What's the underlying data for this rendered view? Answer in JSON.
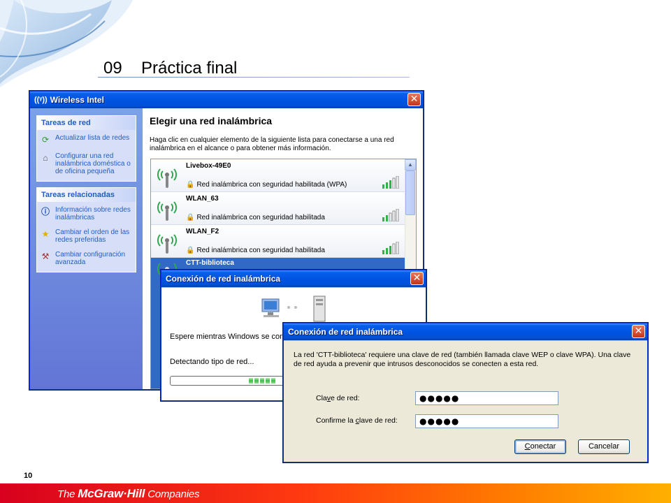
{
  "slide": {
    "number": "09",
    "title": "Práctica final",
    "page": "10",
    "footer_logo_prefix": "The ",
    "footer_logo_brand": "McGraw·Hill",
    "footer_logo_suffix": " Companies"
  },
  "main_window": {
    "title": "Wireless Intel",
    "task_panels": [
      {
        "heading": "Tareas de red",
        "items": [
          {
            "label": "Actualizar lista de redes",
            "icon": "refresh-icon"
          },
          {
            "label": "Configurar una red inalámbrica doméstica o de oficina pequeña",
            "icon": "setup-network-icon"
          }
        ]
      },
      {
        "heading": "Tareas relacionadas",
        "items": [
          {
            "label": "Información sobre redes inalámbricas",
            "icon": "info-icon"
          },
          {
            "label": "Cambiar el orden de las redes preferidas",
            "icon": "star-icon"
          },
          {
            "label": "Cambiar configuración avanzada",
            "icon": "tools-icon"
          }
        ]
      }
    ],
    "content_title": "Elegir una red inalámbrica",
    "content_desc": "Haga clic en cualquier elemento de la siguiente lista para conectarse a una red inalámbrica en el alcance o para obtener más información.",
    "networks": [
      {
        "name": "Livebox-49E0",
        "security": "Red inalámbrica con seguridad habilitada (WPA)",
        "selected": false
      },
      {
        "name": "WLAN_63",
        "security": "Red inalámbrica con seguridad habilitada",
        "selected": false
      },
      {
        "name": "WLAN_F2",
        "security": "Red inalámbrica con seguridad habilitada",
        "selected": false
      },
      {
        "name": "CTT-biblioteca",
        "security": "",
        "selected": true
      }
    ]
  },
  "connect_dialog": {
    "title": "Conexión de red inalámbrica",
    "wait_text": "Espere mientras Windows se conecta",
    "detect_text": "Detectando tipo de red...",
    "progress_percent": 55
  },
  "key_dialog": {
    "title": "Conexión de red inalámbrica",
    "description": "La red 'CTT-biblioteca' requiere una clave de red (también llamada clave WEP o clave WPA). Una clave de red ayuda a prevenir que intrusos desconocidos se conecten a esta red.",
    "key_label_a": "Cla",
    "key_label_u": "v",
    "key_label_b": "e de red:",
    "key_value": "●●●●●",
    "confirm_label_a": "Confirme la ",
    "confirm_label_u": "c",
    "confirm_label_b": "lave de red:",
    "confirm_value": "●●●●●",
    "connect_label_a": "",
    "connect_label_u": "C",
    "connect_label_b": "onectar",
    "cancel_label": "Cancelar"
  }
}
